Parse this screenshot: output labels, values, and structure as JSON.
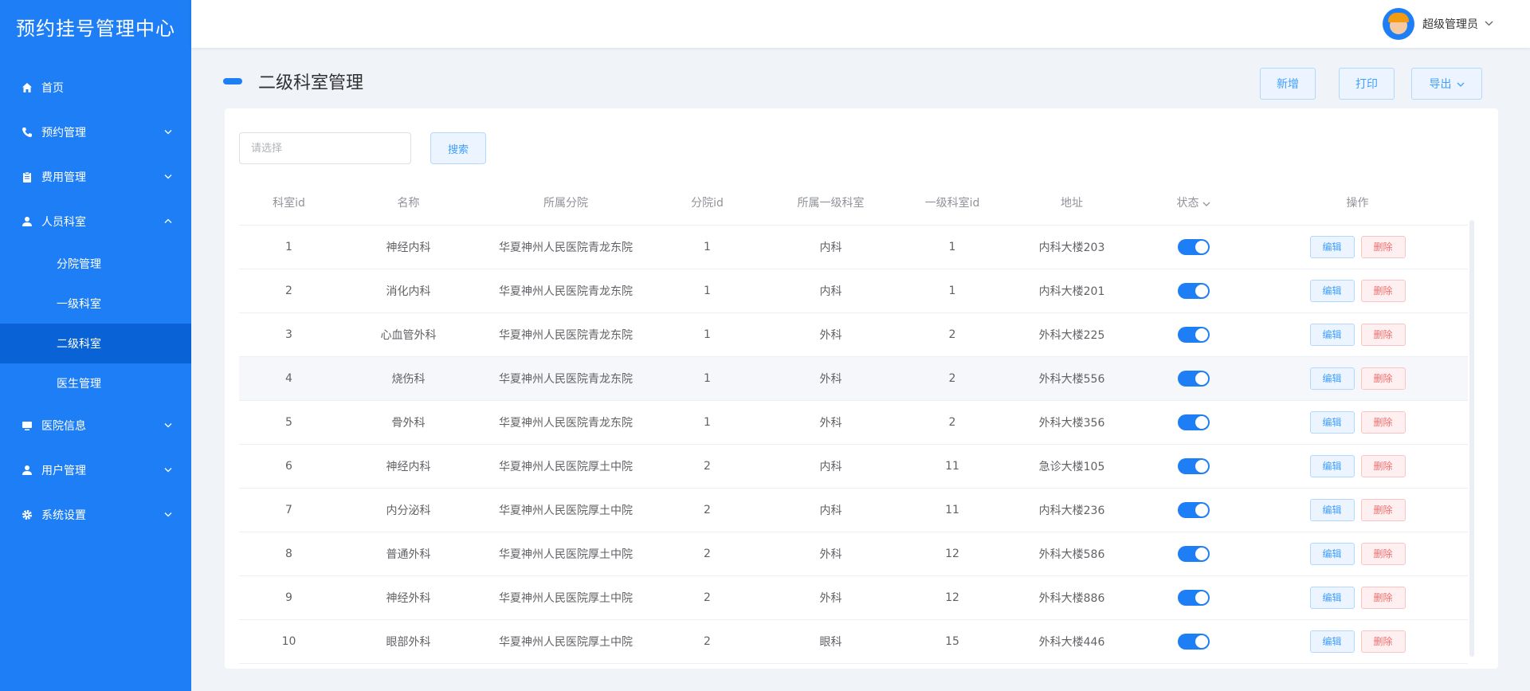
{
  "app_title": "预约挂号管理中心",
  "colors": {
    "brand": "#1e7ef5",
    "active": "#0a63d6",
    "danger": "#f56c6c"
  },
  "sidebar": {
    "items": [
      {
        "label": "首页",
        "icon": "home-icon"
      },
      {
        "label": "预约管理",
        "icon": "phone-icon"
      },
      {
        "label": "费用管理",
        "icon": "clipboard-icon"
      },
      {
        "label": "人员科室",
        "icon": "person-icon",
        "children": [
          "分院管理",
          "一级科室",
          "二级科室",
          "医生管理"
        ]
      },
      {
        "label": "医院信息",
        "icon": "monitor-icon"
      },
      {
        "label": "用户管理",
        "icon": "user-icon"
      },
      {
        "label": "系统设置",
        "icon": "gear-icon"
      }
    ]
  },
  "header": {
    "username": "超级管理员"
  },
  "page": {
    "title": "二级科室管理",
    "buttons": {
      "add": "新增",
      "print": "打印",
      "export": "导出"
    }
  },
  "search": {
    "placeholder": "请选择",
    "button": "搜索"
  },
  "table": {
    "headers": [
      "科室id",
      "名称",
      "所属分院",
      "分院id",
      "所属一级科室",
      "一级科室id",
      "地址",
      "状态",
      "操作"
    ],
    "edit_label": "编辑",
    "delete_label": "删除",
    "rows": [
      [
        "1",
        "神经内科",
        "华夏神州人民医院青龙东院",
        "1",
        "内科",
        "1",
        "内科大楼203"
      ],
      [
        "2",
        "消化内科",
        "华夏神州人民医院青龙东院",
        "1",
        "内科",
        "1",
        "内科大楼201"
      ],
      [
        "3",
        "心血管外科",
        "华夏神州人民医院青龙东院",
        "1",
        "外科",
        "2",
        "外科大楼225"
      ],
      [
        "4",
        "烧伤科",
        "华夏神州人民医院青龙东院",
        "1",
        "外科",
        "2",
        "外科大楼556"
      ],
      [
        "5",
        "骨外科",
        "华夏神州人民医院青龙东院",
        "1",
        "外科",
        "2",
        "外科大楼356"
      ],
      [
        "6",
        "神经内科",
        "华夏神州人民医院厚土中院",
        "2",
        "内科",
        "11",
        "急诊大楼105"
      ],
      [
        "7",
        "内分泌科",
        "华夏神州人民医院厚土中院",
        "2",
        "内科",
        "11",
        "内科大楼236"
      ],
      [
        "8",
        "普通外科",
        "华夏神州人民医院厚土中院",
        "2",
        "外科",
        "12",
        "外科大楼586"
      ],
      [
        "9",
        "神经外科",
        "华夏神州人民医院厚土中院",
        "2",
        "外科",
        "12",
        "外科大楼886"
      ],
      [
        "10",
        "眼部外科",
        "华夏神州人民医院厚土中院",
        "2",
        "眼科",
        "15",
        "外科大楼446"
      ]
    ]
  }
}
